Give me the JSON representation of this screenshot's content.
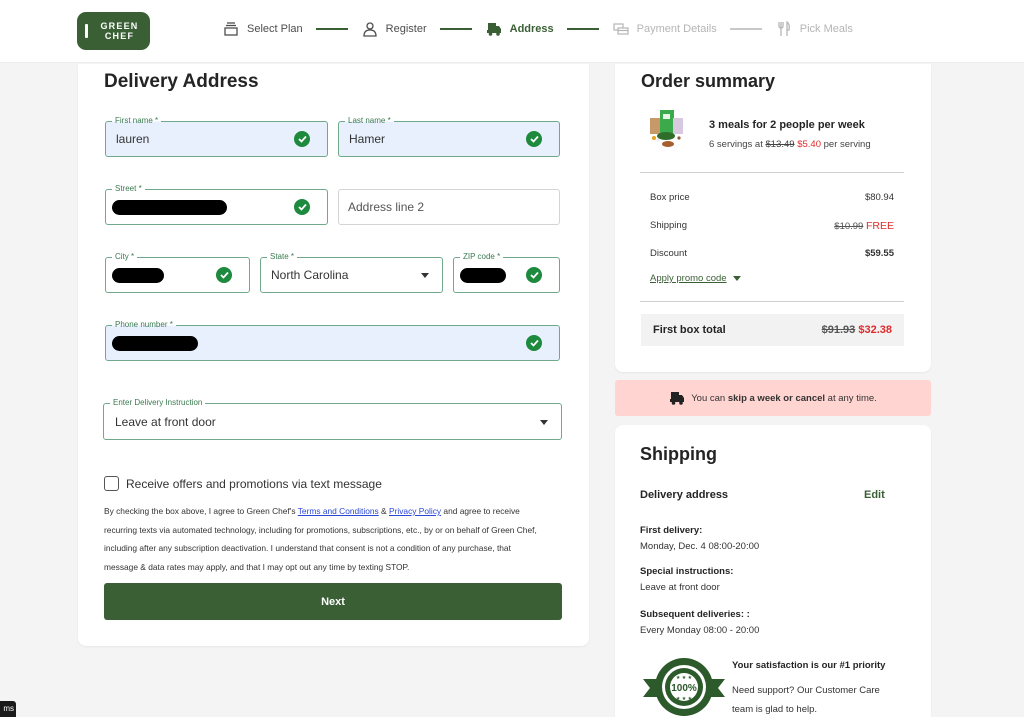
{
  "header": {
    "logo": {
      "line1": "GREEN",
      "line2": "CHEF"
    },
    "steps": [
      {
        "label": "Select Plan",
        "icon": "box-stack-icon",
        "state": "done"
      },
      {
        "label": "Register",
        "icon": "user-icon",
        "state": "done"
      },
      {
        "label": "Address",
        "icon": "delivery-truck-icon",
        "state": "active"
      },
      {
        "label": "Payment Details",
        "icon": "credit-card-icon",
        "state": "todo"
      },
      {
        "label": "Pick Meals",
        "icon": "fork-knife-icon",
        "state": "todo"
      }
    ]
  },
  "form": {
    "title": "Delivery Address",
    "first_name": {
      "label": "First name *",
      "value": "lauren",
      "valid": true
    },
    "last_name": {
      "label": "Last name *",
      "value": "Hamer",
      "valid": true
    },
    "street": {
      "label": "Street *",
      "value": "[redacted]",
      "valid": true
    },
    "address2": {
      "placeholder": "Address line 2",
      "value": ""
    },
    "city": {
      "label": "City *",
      "value": "[redacted]",
      "valid": true
    },
    "state": {
      "label": "State *",
      "value": "North Carolina"
    },
    "zip": {
      "label": "ZIP code *",
      "value": "[redacted]",
      "valid": true
    },
    "phone": {
      "label": "Phone number *",
      "value": "[redacted]",
      "valid": true
    },
    "delivery_instruction": {
      "label": "Enter Delivery Instruction",
      "value": "Leave at front door"
    },
    "sms_opt_in": {
      "label": "Receive offers and promotions via text message",
      "checked": false
    },
    "legal": {
      "part1": "By checking the box above, I agree to Green Chef's ",
      "terms_link": "Terms and Conditions",
      "amp": " & ",
      "privacy_link": "Privacy Policy",
      "part2": " and agree to receive recurring texts via automated technology, including for promotions, subscriptions, etc., by or on behalf of Green Chef, including after any subscription deactivation. I understand that consent is not a condition of any purchase, that message & data rates may apply, and that I may opt out any time by texting STOP."
    },
    "next_label": "Next"
  },
  "summary": {
    "title": "Order summary",
    "plan_title": "3 meals for 2 people per week",
    "servings_prefix": "6 servings at ",
    "old_per_serving": "$13.49",
    "new_per_serving": "$5.40",
    "servings_suffix": " per serving",
    "box_price_label": "Box price",
    "box_price": "$80.94",
    "shipping_label": "Shipping",
    "shipping_old": "$10.99",
    "shipping_new": "FREE",
    "discount_label": "Discount",
    "discount": "$59.55",
    "promo_label": "Apply promo code",
    "total_label": "First box total",
    "total_old": "$91.93",
    "total_new": "$32.38"
  },
  "banner": {
    "prefix": "You can ",
    "bold": "skip a week or cancel",
    "suffix": " at any time."
  },
  "shipping": {
    "title": "Shipping",
    "delivery_address_label": "Delivery address",
    "edit_label": "Edit",
    "first_delivery_label": "First delivery:",
    "first_delivery": "Monday, Dec. 4 08:00-20:00",
    "special_label": "Special instructions:",
    "special": "Leave at front door",
    "subsequent_label": "Subsequent deliveries: :",
    "subsequent": "Every Monday 08:00 - 20:00",
    "satisfaction_title": "Your satisfaction is our #1 priority",
    "satisfaction_text": "Need support? Our Customer Care team is glad to help.",
    "badge_text": "100%"
  },
  "overlay": {
    "tooltip": "ms"
  },
  "colors": {
    "brand_green": "#3a5f35",
    "valid_green": "#1d8a3e",
    "price_red": "#e02b2b",
    "banner_pink": "#ffd4d1"
  }
}
